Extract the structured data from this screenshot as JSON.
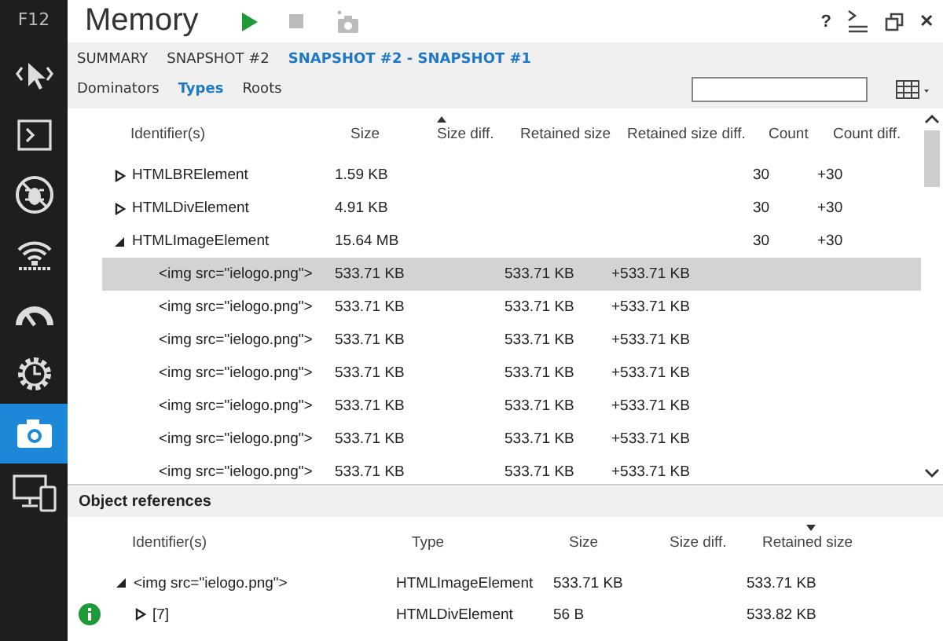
{
  "sidebar": {
    "label": "F12",
    "tools": [
      {
        "kind": "pointer",
        "selected": false
      },
      {
        "kind": "console",
        "selected": false
      },
      {
        "kind": "debugger",
        "selected": false
      },
      {
        "kind": "network",
        "selected": false
      },
      {
        "kind": "performance",
        "selected": false
      },
      {
        "kind": "timeline",
        "selected": false
      },
      {
        "kind": "memory",
        "selected": true
      },
      {
        "kind": "emulation",
        "selected": false
      }
    ]
  },
  "window": {
    "title": "Memory"
  },
  "toolbar": [
    {
      "kind": "play",
      "disabled": false
    },
    {
      "kind": "stop",
      "disabled": true
    },
    {
      "kind": "snapshot",
      "disabled": true
    }
  ],
  "window_buttons": [
    {
      "kind": "help",
      "label": "?"
    },
    {
      "kind": "console"
    },
    {
      "kind": "restore"
    },
    {
      "kind": "close",
      "label": "✕"
    }
  ],
  "tabs": [
    {
      "label": "SUMMARY",
      "selected": false
    },
    {
      "label": "SNAPSHOT #2",
      "selected": false
    },
    {
      "label": "SNAPSHOT #2 - SNAPSHOT #1",
      "selected": true
    }
  ],
  "views": [
    {
      "label": "Dominators",
      "selected": false
    },
    {
      "label": "Types",
      "selected": true
    },
    {
      "label": "Roots",
      "selected": false
    }
  ],
  "table": {
    "columns": [
      {
        "label": "Identifier(s)",
        "sorted": false
      },
      {
        "label": "Size",
        "sorted": false
      },
      {
        "label": "Size diff.",
        "sorted": true
      },
      {
        "label": "Retained size",
        "sorted": false
      },
      {
        "label": "Retained size diff.",
        "sorted": false
      },
      {
        "label": "Count",
        "sorted": false
      },
      {
        "label": "Count diff.",
        "sorted": false
      }
    ],
    "rows": [
      {
        "cells": [
          "HTMLBRElement",
          "1.59 KB",
          "",
          "",
          "",
          "30",
          "+30"
        ],
        "expanded": false,
        "selected": false
      },
      {
        "cells": [
          "HTMLDivElement",
          "4.91 KB",
          "",
          "",
          "",
          "30",
          "+30"
        ],
        "expanded": false,
        "selected": false
      },
      {
        "cells": [
          "HTMLImageElement",
          "15.64 MB",
          "",
          "",
          "",
          "30",
          "+30"
        ],
        "expanded": true,
        "selected": false,
        "children": [
          {
            "cells": [
              "<img src=\"ielogo.png\">",
              "533.71 KB",
              "",
              "533.71 KB",
              "+533.71 KB",
              "",
              ""
            ],
            "selected": true
          },
          {
            "cells": [
              "<img src=\"ielogo.png\">",
              "533.71 KB",
              "",
              "533.71 KB",
              "+533.71 KB",
              "",
              ""
            ],
            "selected": false
          },
          {
            "cells": [
              "<img src=\"ielogo.png\">",
              "533.71 KB",
              "",
              "533.71 KB",
              "+533.71 KB",
              "",
              ""
            ],
            "selected": false
          },
          {
            "cells": [
              "<img src=\"ielogo.png\">",
              "533.71 KB",
              "",
              "533.71 KB",
              "+533.71 KB",
              "",
              ""
            ],
            "selected": false
          },
          {
            "cells": [
              "<img src=\"ielogo.png\">",
              "533.71 KB",
              "",
              "533.71 KB",
              "+533.71 KB",
              "",
              ""
            ],
            "selected": false
          },
          {
            "cells": [
              "<img src=\"ielogo.png\">",
              "533.71 KB",
              "",
              "533.71 KB",
              "+533.71 KB",
              "",
              ""
            ],
            "selected": false
          },
          {
            "cells": [
              "<img src=\"ielogo.png\">",
              "533.71 KB",
              "",
              "533.71 KB",
              "+533.71 KB",
              "",
              ""
            ],
            "selected": false
          }
        ]
      }
    ]
  },
  "references": {
    "title": "Object references",
    "columns": [
      {
        "label": "Identifier(s)",
        "sorted": false
      },
      {
        "label": "Type",
        "sorted": false
      },
      {
        "label": "Size",
        "sorted": false
      },
      {
        "label": "Size diff.",
        "sorted": false
      },
      {
        "label": "Retained size",
        "sorted": true
      }
    ],
    "rows": [
      {
        "cells": [
          "<img src=\"ielogo.png\">",
          "HTMLImageElement",
          "533.71 KB",
          "",
          "533.71 KB"
        ],
        "expanded": true,
        "info": false,
        "children": [
          {
            "cells": [
              "[7]",
              "HTMLDivElement",
              "56 B",
              "",
              "533.82 KB"
            ],
            "expanded": false,
            "info": true
          }
        ]
      }
    ]
  }
}
